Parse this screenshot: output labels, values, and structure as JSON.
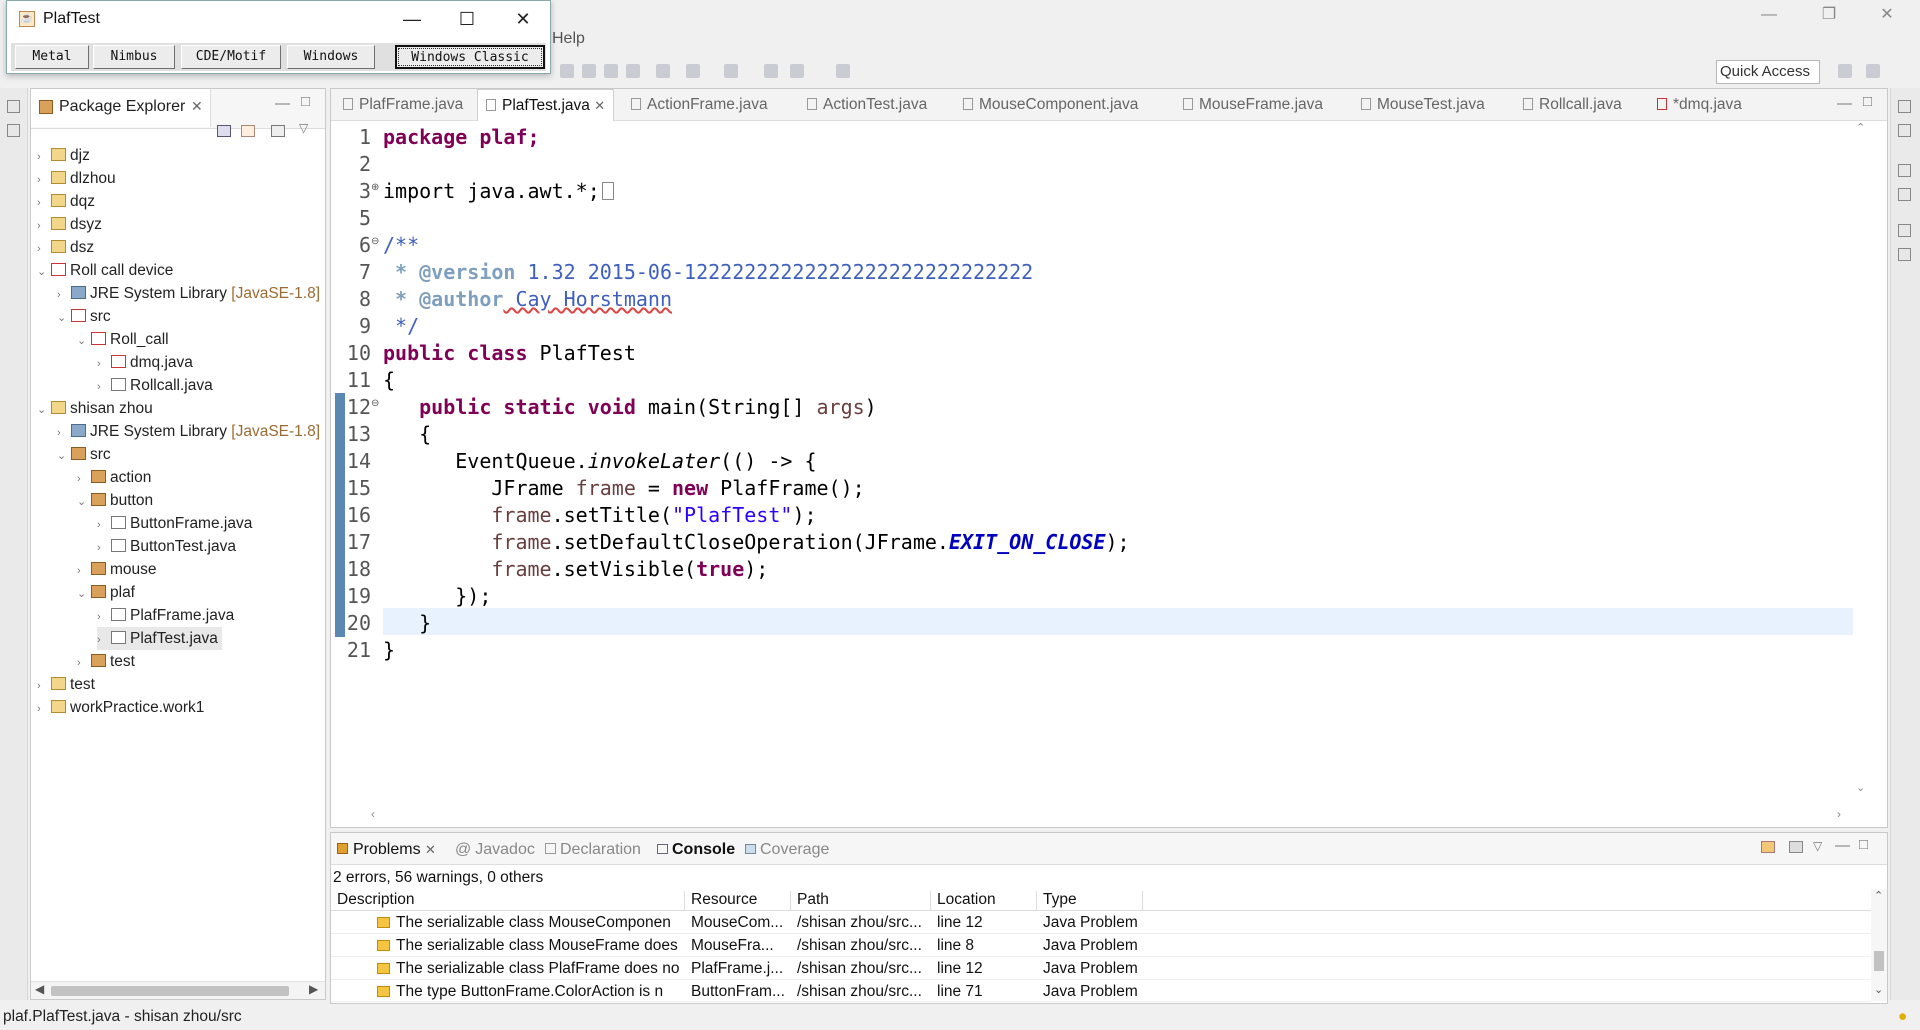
{
  "menubar": {
    "help": "Help"
  },
  "toolbar": {
    "quick_access": "Quick Access"
  },
  "plaf_window": {
    "title": "PlafTest",
    "buttons": [
      "Metal",
      "Nimbus",
      "CDE/Motif",
      "Windows",
      "Windows Classic"
    ],
    "selected": "Windows Classic"
  },
  "package_explorer": {
    "title": "Package Explorer",
    "tree": [
      {
        "label": "djz",
        "icon": "project"
      },
      {
        "label": "dlzhou",
        "icon": "project"
      },
      {
        "label": "dqz",
        "icon": "project"
      },
      {
        "label": "dsyz",
        "icon": "project"
      },
      {
        "label": "dsz",
        "icon": "project"
      },
      {
        "label": "Roll call device",
        "icon": "project-error"
      },
      {
        "label": "JRE System Library",
        "qualifier": "[JavaSE-1.8]",
        "icon": "library"
      },
      {
        "label": "src",
        "icon": "source-folder-error"
      },
      {
        "label": "Roll_call",
        "icon": "package-error"
      },
      {
        "label": "dmq.java",
        "icon": "java-file-error"
      },
      {
        "label": "Rollcall.java",
        "icon": "java-file"
      },
      {
        "label": "shisan zhou",
        "icon": "project"
      },
      {
        "label": "JRE System Library",
        "qualifier": "[JavaSE-1.8]",
        "icon": "library"
      },
      {
        "label": "src",
        "icon": "source-folder"
      },
      {
        "label": "action",
        "icon": "package"
      },
      {
        "label": "button",
        "icon": "package"
      },
      {
        "label": "ButtonFrame.java",
        "icon": "java-file"
      },
      {
        "label": "ButtonTest.java",
        "icon": "java-file"
      },
      {
        "label": "mouse",
        "icon": "package"
      },
      {
        "label": "plaf",
        "icon": "package"
      },
      {
        "label": "PlafFrame.java",
        "icon": "java-file"
      },
      {
        "label": "PlafTest.java",
        "icon": "java-file"
      },
      {
        "label": "test",
        "icon": "package"
      },
      {
        "label": "test",
        "icon": "project"
      },
      {
        "label": "workPractice.work1",
        "icon": "project"
      }
    ]
  },
  "editor": {
    "tabs": [
      "PlafFrame.java",
      "PlafTest.java",
      "ActionFrame.java",
      "ActionTest.java",
      "MouseComponent.java",
      "MouseFrame.java",
      "MouseTest.java",
      "Rollcall.java",
      "*dmq.java"
    ],
    "active_tab": "PlafTest.java",
    "line_numbers": [
      "1",
      "2",
      "3",
      "5",
      "6",
      "7",
      "8",
      "9",
      "10",
      "11",
      "12",
      "13",
      "14",
      "15",
      "16",
      "17",
      "18",
      "19",
      "20",
      "21"
    ],
    "code": {
      "l1": "package plaf;",
      "l3": "import java.awt.*;",
      "l6": "/**",
      "l7_tag": " * @version",
      "l7_text": " 1.32 2015-06-12222222222222222222222222222",
      "l8_tag": " * @author",
      "l8_text": " Cay Horstmann",
      "l9": " */",
      "l10_kw": "public class",
      "l10_name": " PlafTest",
      "l11": "{",
      "l12_kw": "   public static void",
      "l12_rest": " main(String[] ",
      "l12_arg": "args",
      "l12_end": ")",
      "l13": "   {",
      "l14_a": "      EventQueue.",
      "l14_b": "invokeLater",
      "l14_c": "(() -> {",
      "l15_a": "         JFrame ",
      "l15_b": "frame",
      "l15_c": " = ",
      "l15_d": "new",
      "l15_e": " PlafFrame();",
      "l16_a": "         ",
      "l16_b": "frame",
      "l16_c": ".setTitle(",
      "l16_d": "\"PlafTest\"",
      "l16_e": ");",
      "l17_a": "         ",
      "l17_b": "frame",
      "l17_c": ".setDefaultCloseOperation(JFrame.",
      "l17_d": "EXIT_ON_CLOSE",
      "l17_e": ");",
      "l18_a": "         ",
      "l18_b": "frame",
      "l18_c": ".setVisible(",
      "l18_d": "true",
      "l18_e": ");",
      "l19": "      });",
      "l20": "   }",
      "l21": "}"
    }
  },
  "bottom_panel": {
    "tabs": [
      "Problems",
      "Javadoc",
      "Declaration",
      "Console",
      "Coverage"
    ],
    "active_tab": "Problems",
    "summary": "2 errors, 56 warnings, 0 others",
    "columns": [
      "Description",
      "Resource",
      "Path",
      "Location",
      "Type"
    ],
    "rows": [
      [
        "The serializable class MouseComponen",
        "MouseCom...",
        "/shisan zhou/src...",
        "line 12",
        "Java Problem"
      ],
      [
        "The serializable class MouseFrame does",
        "MouseFra...",
        "/shisan zhou/src...",
        "line 8",
        "Java Problem"
      ],
      [
        "The serializable class PlafFrame does no",
        "PlafFrame.j...",
        "/shisan zhou/src...",
        "line 12",
        "Java Problem"
      ],
      [
        "The type ButtonFrame.ColorAction is n",
        "ButtonFram...",
        "/shisan zhou/src...",
        "line 71",
        "Java Problem"
      ]
    ]
  },
  "status_bar": {
    "text": "plaf.PlafTest.java - shisan zhou/src"
  },
  "colors": {
    "keyword": "#7f0055",
    "comment": "#3f5fbf",
    "string": "#2a00ff",
    "field": "#0000c0",
    "current_line": "#e8f2fe"
  }
}
